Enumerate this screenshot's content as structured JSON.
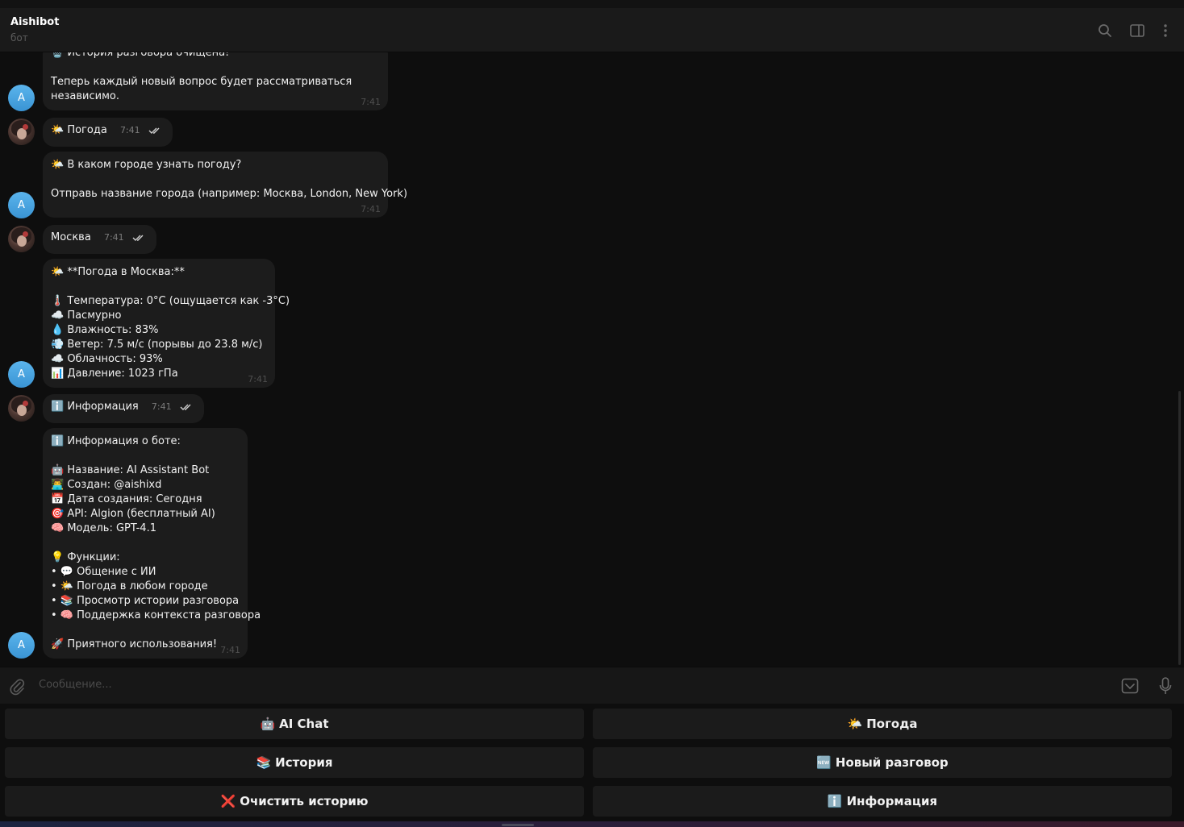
{
  "header": {
    "title": "Aishibot",
    "subtitle": "бот",
    "icons": [
      "search-icon",
      "sidebar-toggle-icon",
      "more-vertical-icon"
    ]
  },
  "avatars": {
    "bot_letter": "A"
  },
  "messages": [
    {
      "from": "bot",
      "lines": [
        "🗑️ История разговора очищена!",
        "",
        "Теперь каждый новый вопрос будет рассматриваться",
        "независимо."
      ],
      "time": "7:41"
    },
    {
      "from": "user",
      "text": "🌤️ Погода",
      "time": "7:41",
      "status": "read"
    },
    {
      "from": "bot",
      "lines": [
        "🌤️ В каком городе узнать погоду?",
        "",
        "Отправь название города (например: Москва, London, New York)"
      ],
      "time": "7:41"
    },
    {
      "from": "user",
      "text": "Москва",
      "time": "7:41",
      "status": "read"
    },
    {
      "from": "bot",
      "lines": [
        "🌤️ **Погода в Москва:**",
        "",
        "🌡️ Температура: 0°C (ощущается как -3°C)",
        "☁️ Пасмурно",
        "💧 Влажность: 83%",
        "💨 Ветер: 7.5 м/с (порывы до 23.8 м/с)",
        "☁️ Облачность: 93%",
        "📊 Давление: 1023 гПа"
      ],
      "time": "7:41"
    },
    {
      "from": "user",
      "text": "ℹ️ Информация",
      "time": "7:41",
      "status": "read"
    },
    {
      "from": "bot",
      "lines": [
        "ℹ️ Информация о боте:",
        "",
        "🤖 Название: AI Assistant Bot",
        "👨‍💻 Создан: @aishixd",
        "📅 Дата создания: Сегодня",
        "🎯 API: Algion (бесплатный AI)",
        "🧠 Модель: GPT-4.1",
        "",
        "💡 Функции:",
        "• 💬 Общение с ИИ",
        "• 🌤️ Погода в любом городе",
        "• 📚 Просмотр истории разговора",
        "• 🧠 Поддержка контекста разговора",
        "",
        "🚀 Приятного использования!"
      ],
      "time": "7:41"
    }
  ],
  "composer": {
    "placeholder": "Сообщение...",
    "icons": [
      "paperclip-icon",
      "keyboard-icon",
      "microphone-icon"
    ]
  },
  "keyboard": {
    "buttons": [
      {
        "emoji": "🤖",
        "label": "AI Chat"
      },
      {
        "emoji": "🌤️",
        "label": "Погода"
      },
      {
        "emoji": "📚",
        "label": "История"
      },
      {
        "emoji": "🆕",
        "label": "Новый разговор"
      },
      {
        "emoji": "❌",
        "label": "Очистить историю"
      },
      {
        "emoji": "ℹ️",
        "label": "Информация"
      }
    ]
  }
}
